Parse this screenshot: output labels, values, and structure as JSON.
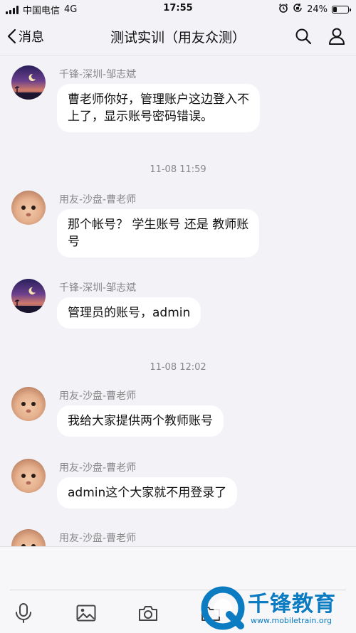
{
  "status_bar": {
    "carrier": "中国电信",
    "network": "4G",
    "time": "17:55",
    "battery_percent": "24%",
    "battery_level": 0.24
  },
  "nav": {
    "back_label": "消息",
    "title": "测试实训（用友众测）"
  },
  "messages": [
    {
      "sender": "千锋-深圳-邹志斌",
      "lines": [
        "曹老师你好，管理账户这边登入不",
        "上了，显示账号密码错误。"
      ]
    },
    {
      "sender": "用友-沙盘-曹老师",
      "lines": [
        "那个帐号？ 学生账号 还是 教师账",
        "号"
      ]
    },
    {
      "sender": "千锋-深圳-邹志斌",
      "lines": [
        "管理员的账号，admin"
      ]
    },
    {
      "sender": "用友-沙盘-曹老师",
      "lines": [
        "我给大家提供两个教师账号"
      ]
    },
    {
      "sender": "用友-沙盘-曹老师",
      "lines": [
        "admin这个大家就不用登录了"
      ]
    },
    {
      "sender": "用友-沙盘-曹老师"
    }
  ],
  "timestamps": [
    "11-08 11:59",
    "11-08 12:02"
  ],
  "toolbar": {
    "icons": [
      "mic-icon",
      "image-icon",
      "camera-icon",
      "folder-icon"
    ]
  },
  "watermark": {
    "text": "千锋教育",
    "url": "www.mobiletrain.org"
  },
  "colors": {
    "background": "#f2f2f7",
    "bubble": "#ffffff",
    "secondary_text": "#888888",
    "watermark": "#0b7bc2"
  }
}
